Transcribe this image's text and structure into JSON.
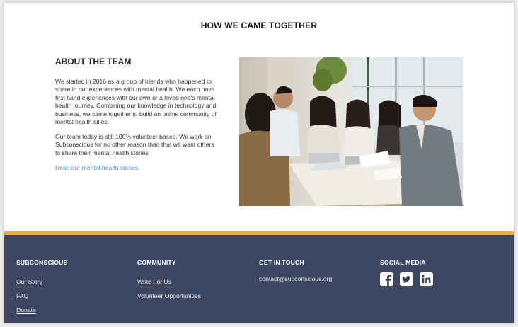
{
  "section": {
    "title": "HOW WE CAME TOGETHER"
  },
  "about": {
    "heading": "ABOUT THE TEAM",
    "paragraph1": "We started in 2016 as a group of friends who happened to share in our experiences with mental health. We each have first hand experiences with our own or a loved one's mental health journey. Combining our knowledge in technology and business, we came together to build an online community of mental health allies.",
    "paragraph2": "Our team today is still 100% volunteer based. We work on Subconscious for no other reason than that we want others to share their mental health stories",
    "link": "Read our mental health stories"
  },
  "photo": {
    "alt": "group of friends at a table"
  },
  "footer": {
    "col1": {
      "heading": "SUBCONSCIOUS",
      "links": [
        "Our Story",
        "FAQ",
        "Donate"
      ]
    },
    "col2": {
      "heading": "COMMUNITY",
      "links": [
        "Write For Us",
        "Volunteer Opportunities"
      ]
    },
    "col3": {
      "heading": "GET IN TOUCH",
      "email": "contact@subconscious.org"
    },
    "col4": {
      "heading": "SOCIAL MEDIA",
      "icons": [
        "facebook-icon",
        "twitter-icon",
        "linkedin-icon"
      ]
    }
  },
  "colors": {
    "footer_bg": "#3c4663",
    "accent_stripe": "#efab3c",
    "link": "#4a90c8"
  }
}
